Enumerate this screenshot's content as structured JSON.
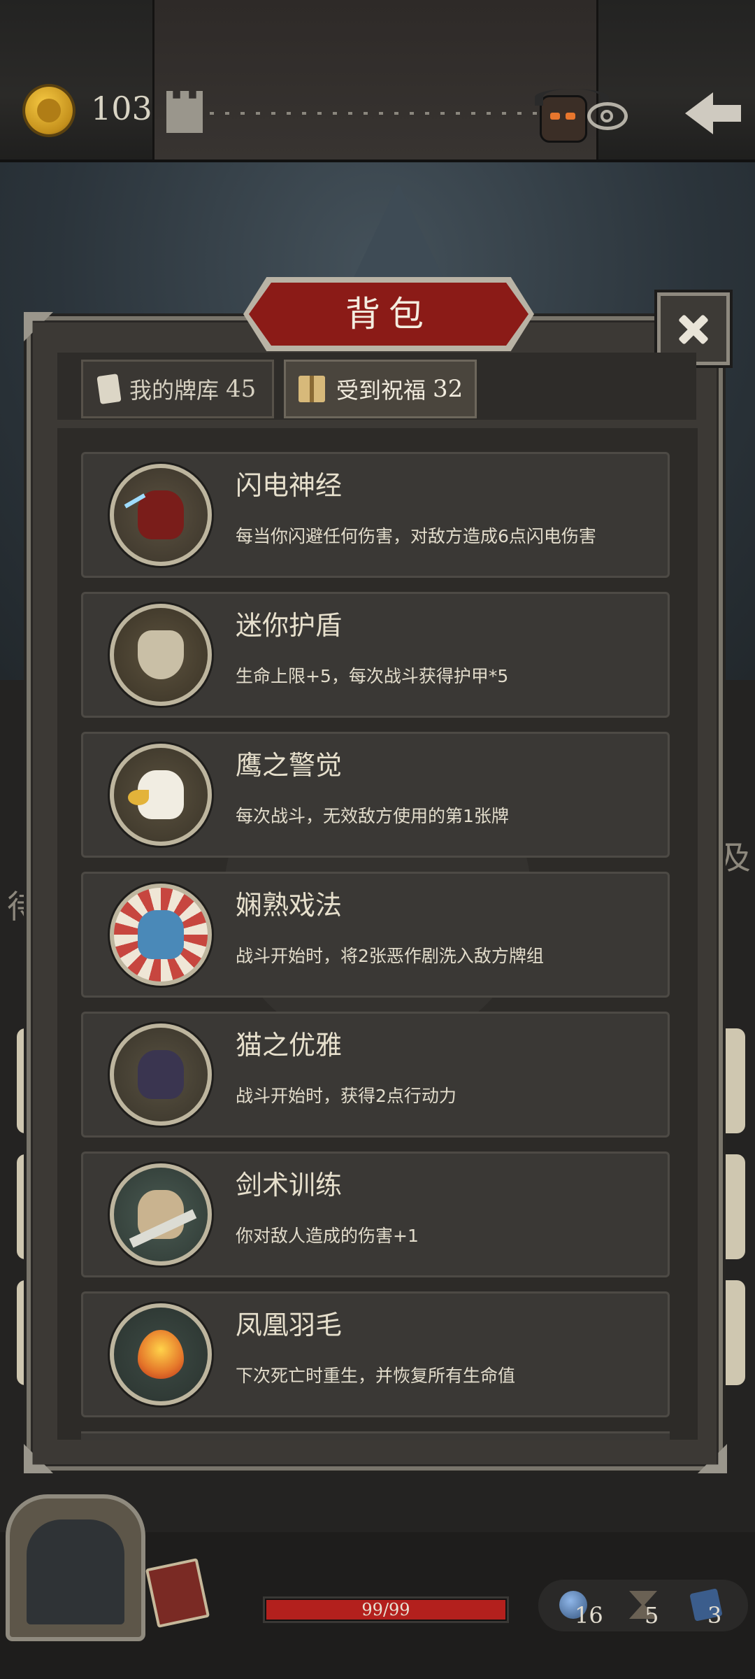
{
  "top_bar": {
    "gold": "103",
    "icons": [
      "coin-icon",
      "tower-icon",
      "boss-icon",
      "eye-icon",
      "back-arrow-icon"
    ]
  },
  "modal": {
    "title": "背包",
    "tabs": [
      {
        "label": "我的牌库",
        "count": "45",
        "icon": "cards-icon"
      },
      {
        "label": "受到祝福",
        "count": "32",
        "icon": "gift-icon"
      }
    ],
    "selected_tab": "受到祝福",
    "blessings": [
      {
        "name": "闪电神经",
        "desc": "每当你闪避任何伤害，对敌方造成6点闪电伤害",
        "icon": "lightning-hood-icon"
      },
      {
        "name": "迷你护盾",
        "desc": "生命上限+5，每次战斗获得护甲*5",
        "icon": "skull-shield-icon"
      },
      {
        "name": "鹰之警觉",
        "desc": "每次战斗，无效敌方使用的第1张牌",
        "icon": "eagle-icon"
      },
      {
        "name": "娴熟戏法",
        "desc": "战斗开始时，将2张恶作剧洗入敌方牌组",
        "icon": "rabbit-magician-icon"
      },
      {
        "name": "猫之优雅",
        "desc": "战斗开始时，获得2点行动力",
        "icon": "cat-icon"
      },
      {
        "name": "剑术训练",
        "desc": "你对敌人造成的伤害+1",
        "icon": "swordsman-icon"
      },
      {
        "name": "凤凰羽毛",
        "desc": "下次死亡时重生，并恢复所有生命值",
        "icon": "phoenix-feather-icon"
      }
    ]
  },
  "background": {
    "side_text_left": "待",
    "side_text_right": "及"
  },
  "bottom_bar": {
    "hp": "99/99",
    "hp_fraction": 1.0,
    "stats": [
      {
        "icon": "orb-icon",
        "value": "16"
      },
      {
        "icon": "hourglass-icon",
        "value": "5"
      },
      {
        "icon": "deck-icon",
        "value": "3"
      }
    ]
  },
  "colors": {
    "title_plate": "#8b1b17",
    "hp_bar": "#b3201d",
    "gold_coin": "#e0b030"
  }
}
